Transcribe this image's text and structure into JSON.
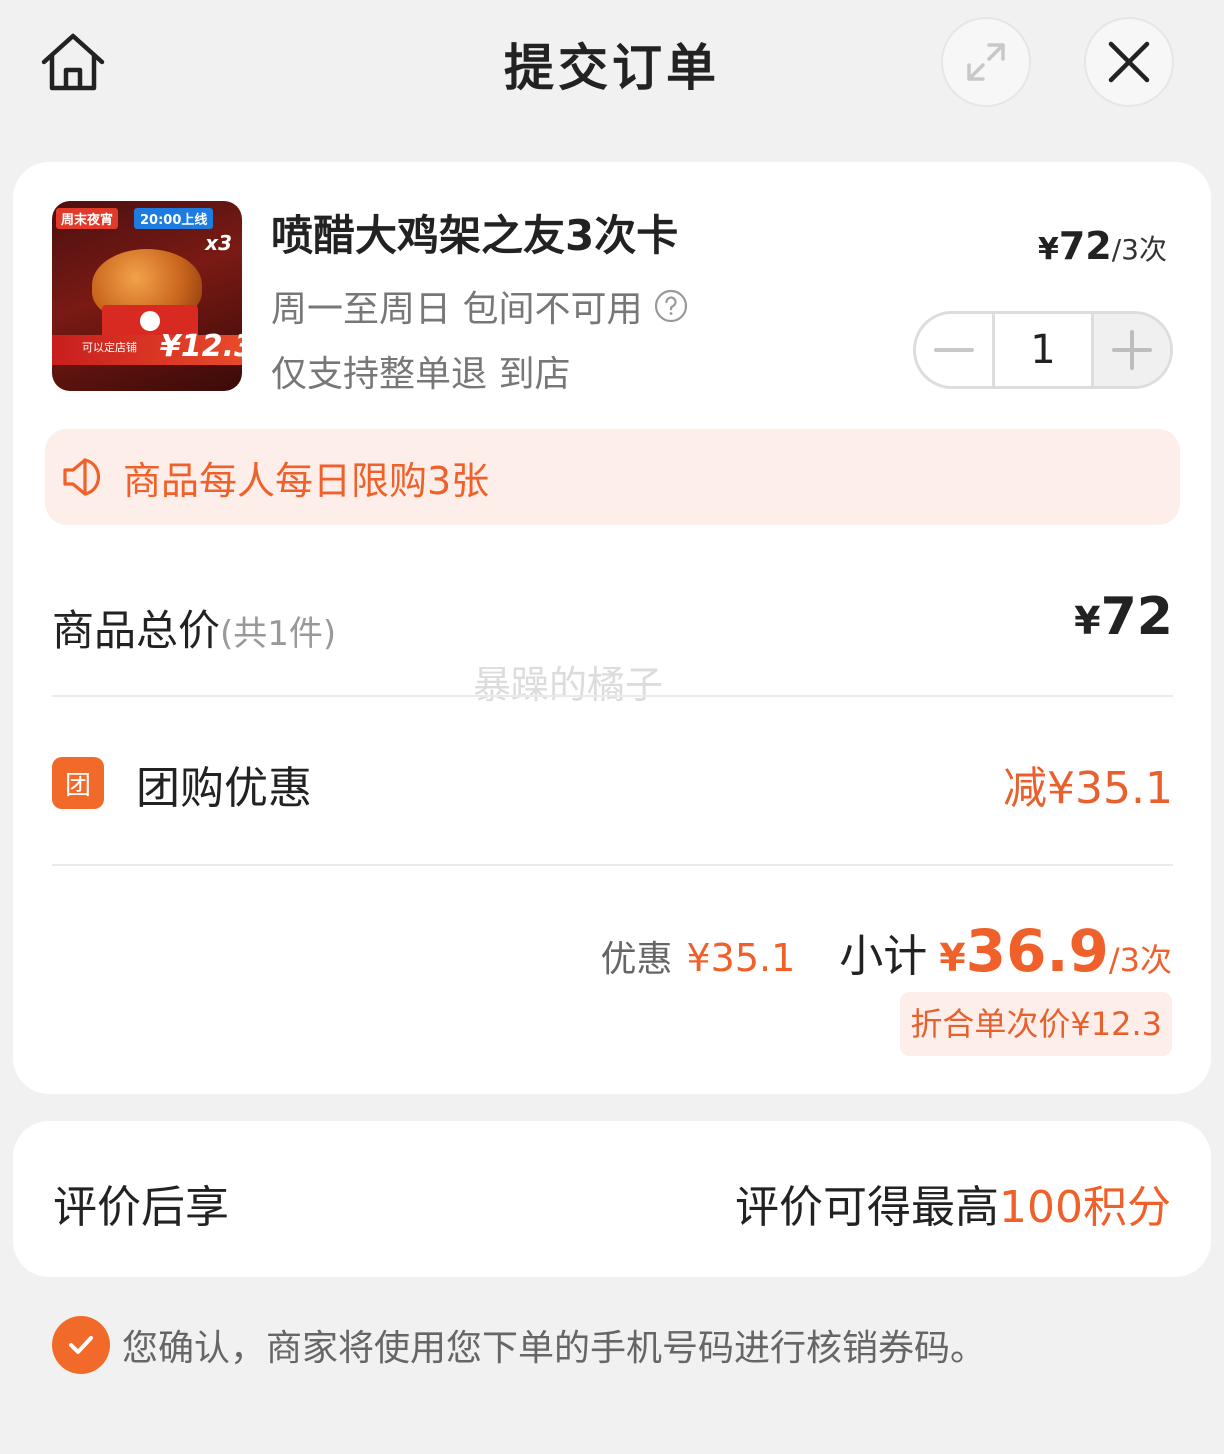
{
  "header": {
    "title": "提交订单"
  },
  "product": {
    "name": "喷醋大鸡架之友3次卡",
    "line1": "周一至周日 包间不可用",
    "line2": "仅支持整单退 到店",
    "price_currency": "¥",
    "price_value": "72",
    "price_unit": "/3次",
    "quantity": "1",
    "thumb": {
      "banner_left": "周末夜宵",
      "banner_right": "20:00上线",
      "badge": "x3",
      "strip": "可以定店铺",
      "price": "¥12.3"
    }
  },
  "notice": {
    "text": "商品每人每日限购3张"
  },
  "total": {
    "label": "商品总价",
    "count": "(共1件)",
    "currency": "¥",
    "amount": "72"
  },
  "watermark": "暴躁的橘子",
  "group_buy": {
    "badge": "团",
    "label": "团购优惠",
    "amount": "减¥35.1"
  },
  "subtotal": {
    "discount_label": "优惠",
    "discount_amount": "¥35.1",
    "label": "小计",
    "currency": "¥",
    "amount": "36.9",
    "unit": "/3次",
    "per_use": "折合单次价¥12.3"
  },
  "review": {
    "label": "评价后享",
    "text": "评价可得最高",
    "points": "100积分"
  },
  "consent": {
    "text": "您确认，商家将使用您下单的手机号码进行核销券码。",
    "checked": true
  },
  "colors": {
    "accent": "#f0602a",
    "notice_bg": "#fdeeea",
    "page_bg": "#f2f1f1"
  }
}
